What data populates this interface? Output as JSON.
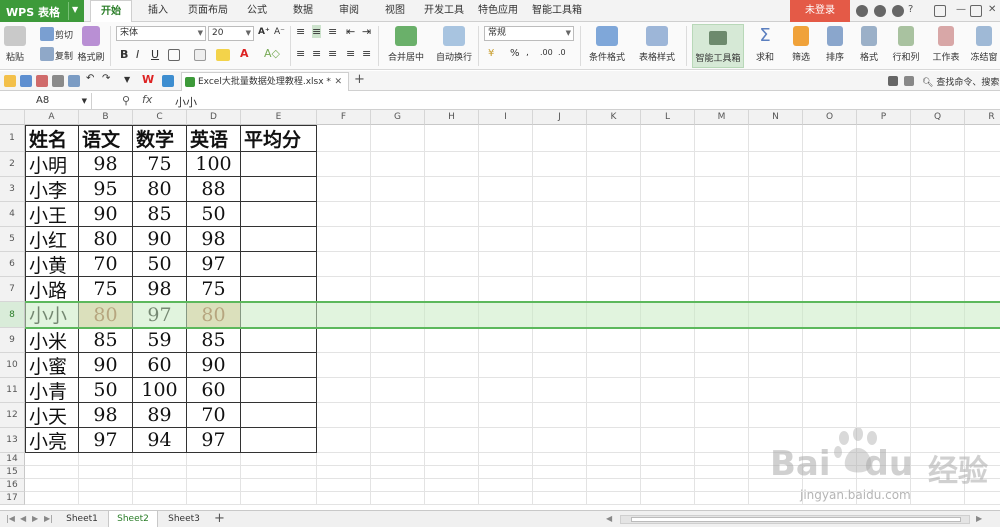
{
  "app": {
    "logo": "WPS 表格",
    "login": "未登录"
  },
  "menus": [
    "开始",
    "插入",
    "页面布局",
    "公式",
    "数据",
    "审阅",
    "视图",
    "开发工具",
    "特色应用",
    "智能工具箱"
  ],
  "ribbon": {
    "paste": "粘贴",
    "cut": "剪切",
    "copy": "复制",
    "format_painter": "格式刷",
    "font": "宋体",
    "size": "20",
    "merge": "合并居中",
    "wrap": "自动换行",
    "number_format": "常规",
    "cond_format": "条件格式",
    "table_style": "表格样式",
    "smart_box": "智能工具箱",
    "sum": "求和",
    "filter": "筛选",
    "sort": "排序",
    "format": "格式",
    "rowcol": "行和列",
    "worksheet": "工作表",
    "freeze": "冻结窗"
  },
  "file_tab": "Excel大批量数据处理教程.xlsx *",
  "search_cmd": "查找命令、搜索",
  "formula_bar": {
    "name_box": "A8",
    "fx": "fx",
    "value": "小小"
  },
  "columns": [
    "A",
    "B",
    "C",
    "D",
    "E",
    "F",
    "G",
    "H",
    "I",
    "J",
    "K",
    "L",
    "M",
    "N",
    "O",
    "P",
    "Q",
    "R"
  ],
  "rows": [
    "1",
    "2",
    "3",
    "4",
    "5",
    "6",
    "7",
    "8",
    "9",
    "10",
    "11",
    "12",
    "13",
    "14",
    "15",
    "16",
    "17"
  ],
  "table": {
    "header": [
      "姓名",
      "语文",
      "数学",
      "英语",
      "平均分"
    ],
    "rows": [
      [
        "小明",
        "98",
        "75",
        "100",
        ""
      ],
      [
        "小李",
        "95",
        "80",
        "88",
        ""
      ],
      [
        "小王",
        "90",
        "85",
        "50",
        ""
      ],
      [
        "小红",
        "80",
        "90",
        "98",
        ""
      ],
      [
        "小黄",
        "70",
        "50",
        "97",
        ""
      ],
      [
        "小路",
        "75",
        "98",
        "75",
        ""
      ],
      [
        "小小",
        "80",
        "97",
        "80",
        ""
      ],
      [
        "小米",
        "85",
        "59",
        "85",
        ""
      ],
      [
        "小蜜",
        "90",
        "60",
        "90",
        ""
      ],
      [
        "小青",
        "50",
        "100",
        "60",
        ""
      ],
      [
        "小天",
        "98",
        "89",
        "70",
        ""
      ],
      [
        "小亮",
        "97",
        "94",
        "97",
        ""
      ]
    ]
  },
  "sheets": [
    "Sheet1",
    "Sheet2",
    "Sheet3"
  ],
  "active_sheet": "Sheet2",
  "watermark": {
    "brand": "Bai",
    "brand2": "du",
    "cn": "经验",
    "url": "jingyan.baidu.com"
  },
  "colors": {
    "accent": "#3d9a3a",
    "highlight": "#f2d2b3",
    "row_select": "#5cb85c",
    "login": "#e45a47"
  }
}
